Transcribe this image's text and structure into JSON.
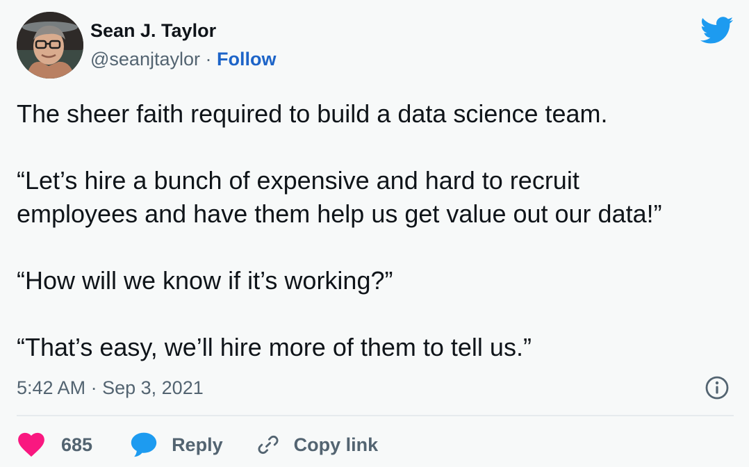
{
  "author": {
    "name": "Sean J. Taylor",
    "handle": "@seanjtaylor",
    "separator": "·",
    "follow_label": "Follow"
  },
  "tweet": {
    "paragraphs": [
      "The sheer faith required to build a data science team.",
      "“Let’s hire a bunch of expensive and hard to recruit\nemployees and have them help us get value out our data!”",
      "“How will we know if it’s working?”",
      "“That’s easy, we’ll hire more of them to tell us.”"
    ],
    "time": "5:42 AM",
    "separator": "·",
    "date": "Sep 3, 2021"
  },
  "actions": {
    "like_count": "685",
    "reply_label": "Reply",
    "copy_link_label": "Copy link"
  },
  "icons": {
    "brand": "twitter-bird-icon",
    "info": "info-icon",
    "like": "heart-icon",
    "reply": "speech-bubble-icon",
    "copy": "link-icon"
  },
  "colors": {
    "brand": "#1d9bf0",
    "follow": "#1d64c8",
    "like": "#f91880",
    "secondary_text": "#536471",
    "text": "#0f1419",
    "background": "#f7f9f9"
  }
}
